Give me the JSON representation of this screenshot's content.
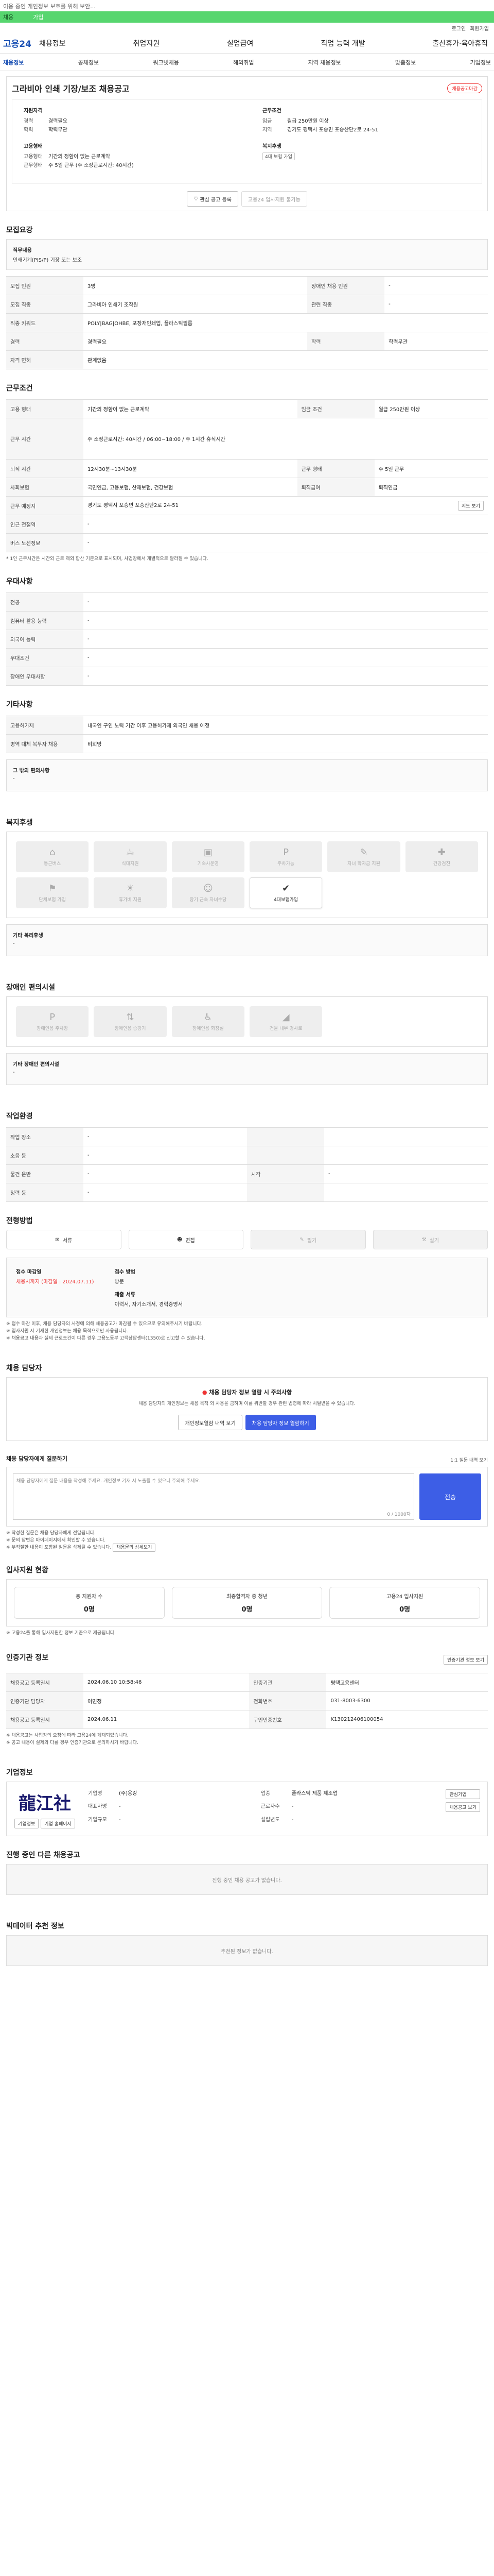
{
  "top": {
    "notice": "이용 중인 개인정보 보호를 위해 보안...",
    "green_sel": "채용",
    "green_val": "가입",
    "util": [
      "로그인",
      "회원가입"
    ],
    "logo": "고용24",
    "gnb": [
      "채용정보",
      "취업지원",
      "실업급여",
      "직업 능력 개발",
      "출산휴가·육아휴직"
    ],
    "subnav": [
      "채용정보",
      "공채정보",
      "워크넷채용",
      "해외취업",
      "지역 채용정보",
      "맞춤정보",
      "기업정보"
    ]
  },
  "job": {
    "title": "그라비아 인쇄 기장/보조 채용공고",
    "status_badge": "채용공고마감",
    "overview": {
      "qual_title": "지원자격",
      "qual_rows": [
        {
          "k": "경력",
          "v": "경력필요"
        },
        {
          "k": "학력",
          "v": "학력무관"
        }
      ],
      "cond_title": "근무조건",
      "cond_rows": [
        {
          "k": "임금",
          "v": "월급 250만원 이상"
        },
        {
          "k": "지역",
          "v": "경기도 평택시 포승면 포승산단2로 24-51"
        }
      ],
      "emp_title": "고용형태",
      "emp_rows": [
        {
          "k": "고용형태",
          "v": "기간의 정함이 없는 근로계약"
        },
        {
          "k": "근무형태",
          "v": "주 5일 근무 (주 소정근로시간: 40시간)"
        }
      ],
      "welfare_title": "복지후생",
      "welfare_tag": "4대 보험 가입"
    },
    "actions": {
      "interest": "관심 공고 등록",
      "apply": "고용24 입사지원 불가능"
    }
  },
  "recruit": {
    "title": "모집요강",
    "duty_title": "직무내용",
    "duty": "인쇄기계(PIS/P) 기장 또는 보조",
    "rows": [
      {
        "k": "모집 인원",
        "v": "3명",
        "k2": "장애인 채용 인원",
        "v2": "-"
      },
      {
        "k": "모집 직종",
        "v": "그라비아 인쇄기 조작원",
        "k2": "관련 직종",
        "v2": "-"
      },
      {
        "k": "직종 키워드",
        "v": "POLY|BAG|OHBE, 포장재인쇄업, 플라스틱필름",
        "k2": "",
        "v2": ""
      },
      {
        "k": "경력",
        "v": "경력필요",
        "k2": "학력",
        "v2": "학력무관"
      },
      {
        "k": "자격 면허",
        "v": "관계없음",
        "k2": "",
        "v2": ""
      }
    ]
  },
  "work": {
    "title": "근무조건",
    "rows": [
      {
        "k": "고용 형태",
        "v": "기간의 정함이 없는 근로계약",
        "k2": "임금 조건",
        "v2": "월급 250만원 이상"
      },
      {
        "k": "근무 시간",
        "v": "주 소정근로시간: 40시간 / 06:00~18:00 / 주 1시간 휴식시간",
        "k2": "",
        "v2": ""
      },
      {
        "k": "퇴직 시간",
        "v": "12시30분~13시30분",
        "k2": "근무 형태",
        "v2": "주 5일 근무"
      },
      {
        "k": "사회보험",
        "v": "국민연금, 고용보험, 산재보험, 건강보험",
        "k2": "퇴직급여",
        "v2": "퇴직연금"
      },
      {
        "k": "근무 예정지",
        "v": "경기도 평택시 포승면 포승산단2로 24-51",
        "k2": "",
        "v2": ""
      },
      {
        "k": "인근 전철역",
        "v": "-",
        "k2": "",
        "v2": ""
      },
      {
        "k": "버스 노선정보",
        "v": "-",
        "k2": "",
        "v2": ""
      }
    ],
    "map_btn": "지도 보기",
    "note": "* 1인 근무시간은 시간외 근로 제외 합산 기준으로 표시되며, 사업장에서 개별적으로 달라질 수 있습니다."
  },
  "pref": {
    "title": "우대사항",
    "rows": [
      {
        "k": "전공",
        "v": "-"
      },
      {
        "k": "컴퓨터 활용 능력",
        "v": "-"
      },
      {
        "k": "외국어 능력",
        "v": "-"
      },
      {
        "k": "우대조건",
        "v": "-"
      },
      {
        "k": "장애인 우대사항",
        "v": "-"
      }
    ]
  },
  "etc": {
    "title": "기타사항",
    "rows": [
      {
        "k": "고용허가제",
        "v": "내국인 구인 노력 기간 이후 고용허가제 외국인 채용 예정"
      },
      {
        "k": "병역 대체 복무자 채용",
        "v": "비희망"
      }
    ],
    "other_title": "그 밖의 편의사항",
    "other_val": "-"
  },
  "benefit": {
    "title": "복지후생",
    "items": [
      {
        "icon": "home-icon",
        "glyph": "⌂",
        "label": "통근버스"
      },
      {
        "icon": "meal-icon",
        "glyph": "☕",
        "label": "식대지원"
      },
      {
        "icon": "dorm-icon",
        "glyph": "▣",
        "label": "기숙사운영"
      },
      {
        "icon": "parking-icon",
        "glyph": "P",
        "label": "주차가능"
      },
      {
        "icon": "education-icon",
        "glyph": "✎",
        "label": "자녀 학자금 지원"
      },
      {
        "icon": "health-icon",
        "glyph": "✚",
        "label": "건강검진"
      },
      {
        "icon": "insurance-icon",
        "glyph": "⚑",
        "label": "단체보험 가입"
      },
      {
        "icon": "vacation-icon",
        "glyph": "☀",
        "label": "휴가비 지원"
      },
      {
        "icon": "childcare-icon",
        "glyph": "☺",
        "label": "장기 근속 자녀수당"
      },
      {
        "icon": "social-insurance-icon",
        "glyph": "✔",
        "label": "4대보험가입"
      }
    ],
    "active_index": 9,
    "other_title": "기타 복리후생",
    "other_val": "-"
  },
  "disability": {
    "title": "장애인 편의시설",
    "items": [
      "장애인용 주차장",
      "장애인용 승강기",
      "장애인용 화장실",
      "건물 내부 경사로"
    ],
    "other_title": "기타 장애인 편의시설",
    "other_val": "-"
  },
  "env": {
    "title": "작업환경",
    "rows": [
      {
        "k": "작업 장소",
        "v": "-",
        "k2": "",
        "v2": ""
      },
      {
        "k": "소음 등",
        "v": "-",
        "k2": "",
        "v2": ""
      },
      {
        "k": "물건 운반",
        "v": "-",
        "k2": "시각",
        "v2": "-"
      },
      {
        "k": "청력 등",
        "v": "-",
        "k2": "",
        "v2": ""
      }
    ]
  },
  "method": {
    "title": "전형방법",
    "items": [
      {
        "glyph": "✉",
        "label": "서류",
        "on": true
      },
      {
        "glyph": "☻",
        "label": "면접",
        "on": true
      },
      {
        "glyph": "✎",
        "label": "필기",
        "on": false
      },
      {
        "glyph": "⚒",
        "label": "실기",
        "on": false
      }
    ],
    "deadline_title": "접수 마감일",
    "deadline": "채용시까지 (마감일 : 2024.07.11)",
    "receipt_title": "접수 방법",
    "receipt": "방문",
    "docs_title": "제출 서류",
    "docs": "이력서, 자기소개서, 경력증명서",
    "notes": [
      "※ 접수 마감 이후, 채용 담당자의 사정에 의해 채용공고가 마감될 수 있으므로 유의해주시기 바랍니다.",
      "※ 입사지원 시 기재한 개인정보는 채용 목적으로만 사용됩니다.",
      "※ 채용공고 내용과 실제 근로조건이 다른 경우 고용노동부 고객상담센터(1350)로 신고할 수 있습니다."
    ]
  },
  "contact": {
    "title": "채용 담당자",
    "alert": "채용 담당자 정보 열람 시 주의사항",
    "desc": "채용 담당자의 개인정보는 채용 목적 외 사용을 금하며 이를 위반할 경우 관련 법령에 따라 처벌받을 수 있습니다.",
    "btn_log": "개인정보열람 내역 보기",
    "btn_view": "채용 담당자 정보 열람하기"
  },
  "inquiry": {
    "title": "채용 담당자에게 질문하기",
    "link": "1:1 질문 내역 보기",
    "placeholder": "채용 담당자에게 질문 내용을 작성해 주세요. 개인정보 기재 시 노출될 수 있으니 주의해 주세요.",
    "counter": "0 / 1000자",
    "submit": "전송",
    "notes": [
      "※ 작성한 질문은 채용 담당자에게 전달됩니다.",
      "※ 문의 답변은 마이페이지에서 확인할 수 있습니다.",
      "※ 부적절한 내용이 포함된 질문은 삭제될 수 있습니다."
    ],
    "note_btn": "채용문의 상세보기"
  },
  "applicants": {
    "title": "입사지원 현황",
    "items": [
      {
        "label": "총 지원자 수",
        "n": "0명"
      },
      {
        "label": "최종합격자 중 청년",
        "n": "0명"
      },
      {
        "label": "고용24 입사지원",
        "n": "0명"
      }
    ],
    "note": "※ 고용24를 통해 입사지원한 정보 기준으로 제공됩니다."
  },
  "agency": {
    "title": "인증기관 정보",
    "btn": "인증기관 정보 보기",
    "rows": [
      {
        "k": "채용공고 등록일시",
        "v": "2024.06.10 10:58:46",
        "k2": "인증기관",
        "v2": "평택고용센터"
      },
      {
        "k": "인증기관 담당자",
        "v": "이민정",
        "k2": "전화번호",
        "v2": "031-8003-6300"
      },
      {
        "k": "채용공고 등록일시",
        "v": "2024.06.11",
        "k2": "구인인증번호",
        "v2": "K130212406100054"
      }
    ],
    "notes": [
      "※ 채용공고는 사업장의 요청에 따라 고용24에 게재되었습니다.",
      "※ 공고 내용이 실제와 다를 경우 인증기관으로 문의하시기 바랍니다."
    ]
  },
  "company": {
    "title": "기업정보",
    "mark": "龍江社",
    "btn1": "기업정보",
    "btn2": "기업 홈페이지",
    "rows": [
      {
        "k": "기업명",
        "v": "(주)용강"
      },
      {
        "k": "업종",
        "v": "플라스틱 제품 제조업"
      },
      {
        "k": "대표자명",
        "v": "-"
      },
      {
        "k": "근로자수",
        "v": "-"
      },
      {
        "k": "기업규모",
        "v": "-"
      },
      {
        "k": "설립년도",
        "v": "-"
      }
    ],
    "fav": "관심기업",
    "more": "채용공고 보기"
  },
  "same": {
    "title": "진행 중인 다른 채용공고",
    "empty": "진행 중인 채용 공고가 없습니다."
  },
  "recommend": {
    "title": "빅데이터 추천 정보",
    "empty": "추천된 정보가 없습니다."
  }
}
